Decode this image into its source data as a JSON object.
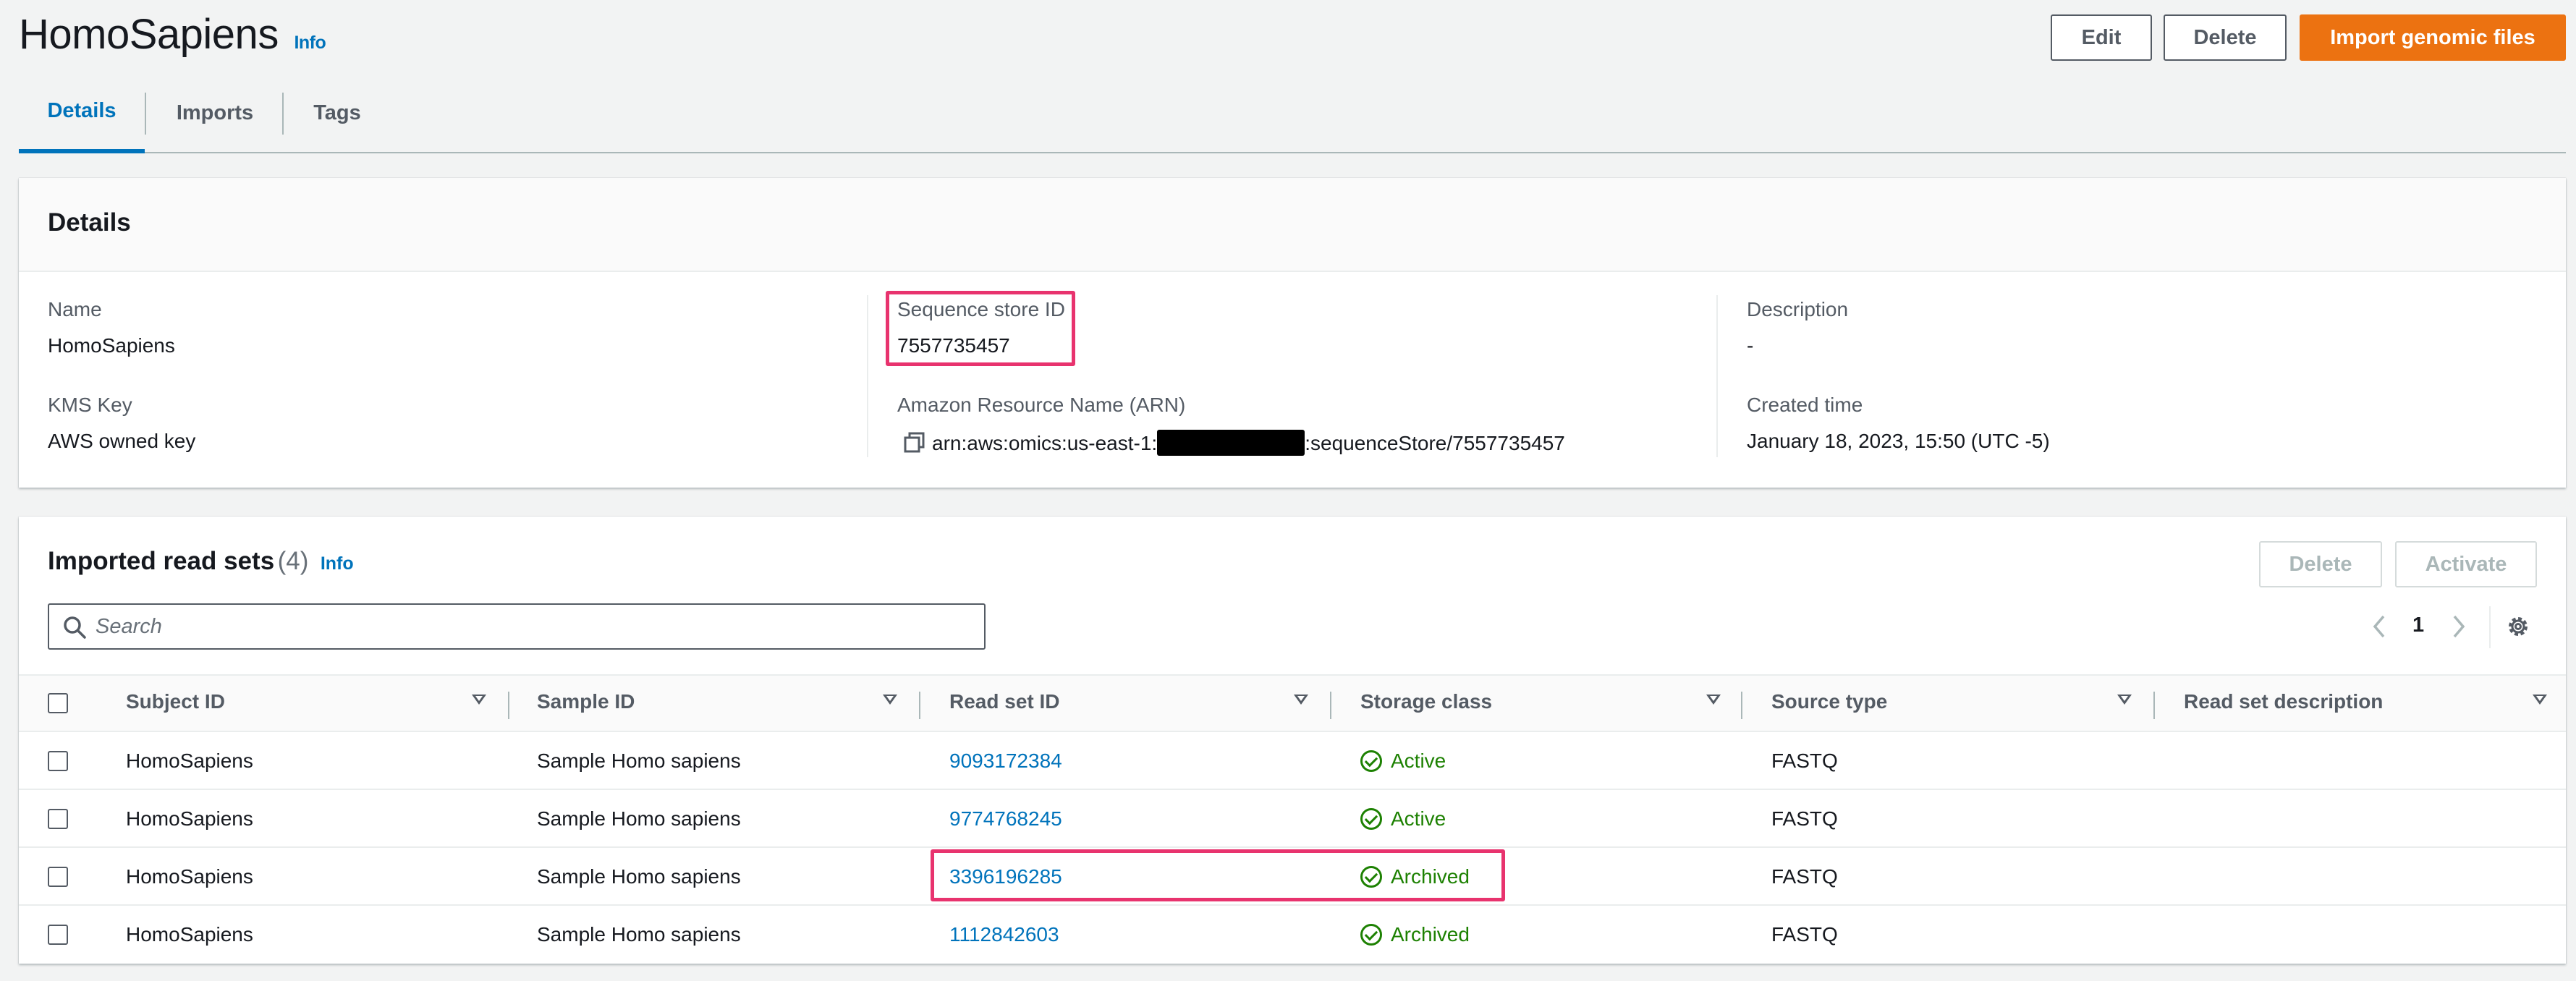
{
  "page": {
    "title": "HomoSapiens",
    "info": "Info"
  },
  "actions": {
    "edit": "Edit",
    "delete": "Delete",
    "import": "Import genomic files"
  },
  "tabs": [
    {
      "label": "Details"
    },
    {
      "label": "Imports"
    },
    {
      "label": "Tags"
    }
  ],
  "details": {
    "heading": "Details",
    "name_label": "Name",
    "name_value": "HomoSapiens",
    "kms_label": "KMS Key",
    "kms_value": "AWS owned key",
    "store_id_label": "Sequence store ID",
    "store_id_value": "7557735457",
    "arn_label": "Amazon Resource Name (ARN)",
    "arn_prefix": "arn:aws:omics:us-east-1:",
    "arn_suffix": ":sequenceStore/7557735457",
    "description_label": "Description",
    "description_value": "-",
    "created_label": "Created time",
    "created_value": "January 18, 2023, 15:50 (UTC -5)"
  },
  "readsets": {
    "heading": "Imported read sets",
    "count": "(4)",
    "info": "Info",
    "delete": "Delete",
    "activate": "Activate",
    "search_placeholder": "Search",
    "page": "1",
    "columns": [
      "Subject ID",
      "Sample ID",
      "Read set ID",
      "Storage class",
      "Source type",
      "Read set description"
    ],
    "rows": [
      {
        "subject": "HomoSapiens",
        "sample": "Sample Homo sapiens",
        "readset": "9093172384",
        "storage": "Active",
        "source": "FASTQ"
      },
      {
        "subject": "HomoSapiens",
        "sample": "Sample Homo sapiens",
        "readset": "9774768245",
        "storage": "Active",
        "source": "FASTQ"
      },
      {
        "subject": "HomoSapiens",
        "sample": "Sample Homo sapiens",
        "readset": "3396196285",
        "storage": "Archived",
        "source": "FASTQ"
      },
      {
        "subject": "HomoSapiens",
        "sample": "Sample Homo sapiens",
        "readset": "1112842603",
        "storage": "Archived",
        "source": "FASTQ"
      }
    ]
  },
  "colors": {
    "accent": "#0073bb",
    "primary": "#ec7211",
    "success": "#1d8102",
    "highlight": "#e8336e"
  }
}
